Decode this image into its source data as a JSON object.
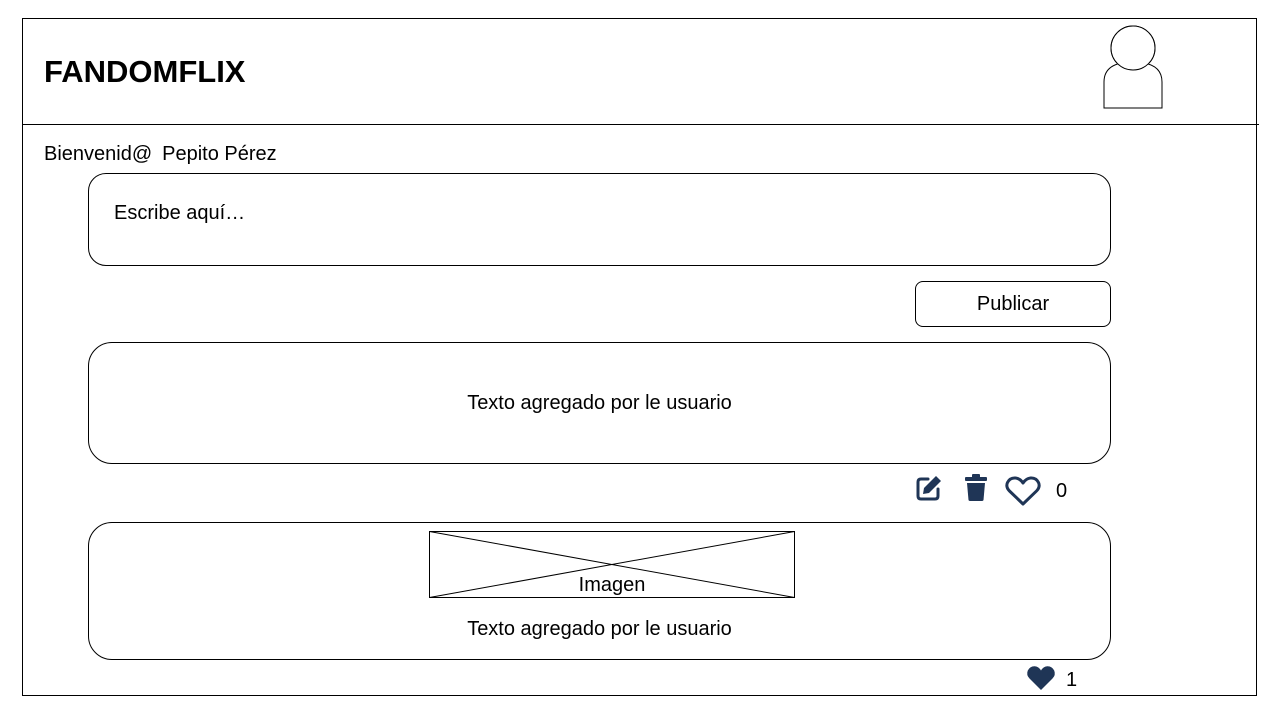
{
  "app": {
    "brand": "FANDOMFLIX"
  },
  "welcome": {
    "greeting": "Bienvenid@",
    "user_name": "Pepito Pérez"
  },
  "composer": {
    "placeholder": "Escribe aquí…",
    "publish_label": "Publicar"
  },
  "posts": [
    {
      "text": "Texto agregado por le usuario",
      "likes": "0",
      "liked": false,
      "actions": [
        "edit-icon",
        "trash-icon",
        "heart-outline-icon"
      ]
    },
    {
      "image_label": "Imagen",
      "text": "Texto agregado por le usuario",
      "likes": "1",
      "liked": true,
      "actions": [
        "heart-filled-icon"
      ]
    }
  ],
  "colors": {
    "icon": "#1F3556",
    "border": "#000000",
    "background": "#FFFFFF"
  }
}
